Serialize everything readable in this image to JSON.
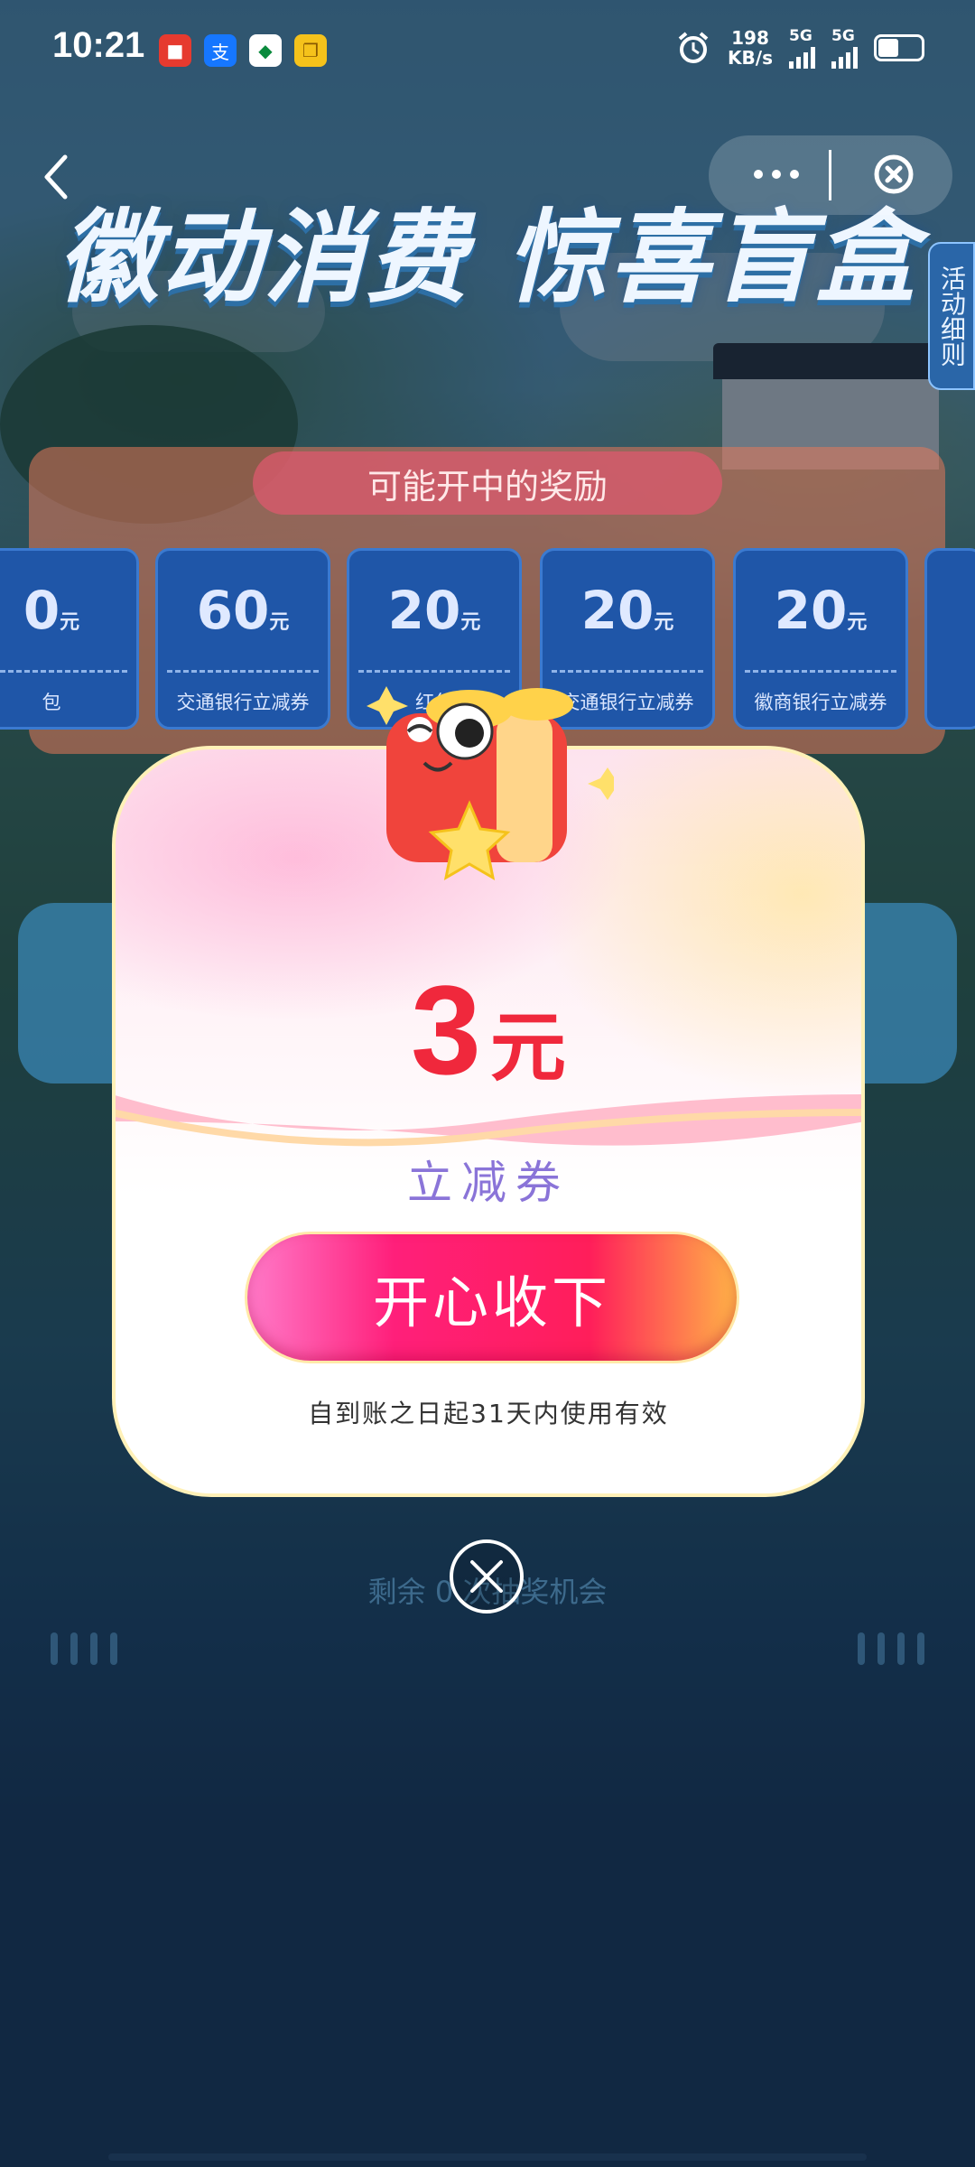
{
  "status_bar": {
    "time": "10:21",
    "net_speed_value": "198",
    "net_speed_unit": "KB/s",
    "sim1": "5G",
    "sim2": "5G",
    "app_icons": [
      "jd-app-icon",
      "alipay-icon",
      "bank-icon",
      "clone-icon"
    ]
  },
  "header": {
    "title": "徽动消费 惊喜盲盒",
    "rules_tab": "活动细则",
    "more_icon": "more-dots-icon",
    "close_icon": "close-circle-icon"
  },
  "rewards_panel": {
    "title": "可能开中的奖励",
    "unit": "元",
    "coupons": [
      {
        "amount": "0",
        "label": "包"
      },
      {
        "amount": "60",
        "label": "交通银行立减券"
      },
      {
        "amount": "20",
        "label": "红包"
      },
      {
        "amount": "20",
        "label": "交通银行立减券"
      },
      {
        "amount": "20",
        "label": "徽商银行立减券"
      }
    ]
  },
  "background": {
    "remaining_text": "剩余 0 次抽奖机会"
  },
  "modal": {
    "amount": "3",
    "unit": "元",
    "type": "立减券",
    "accept_button": "开心收下",
    "validity": "自到账之日起31天内使用有效"
  },
  "colors": {
    "accent_red": "#f0283c",
    "button_pink": "#ff1f7a",
    "type_purple": "#8a74d8"
  }
}
